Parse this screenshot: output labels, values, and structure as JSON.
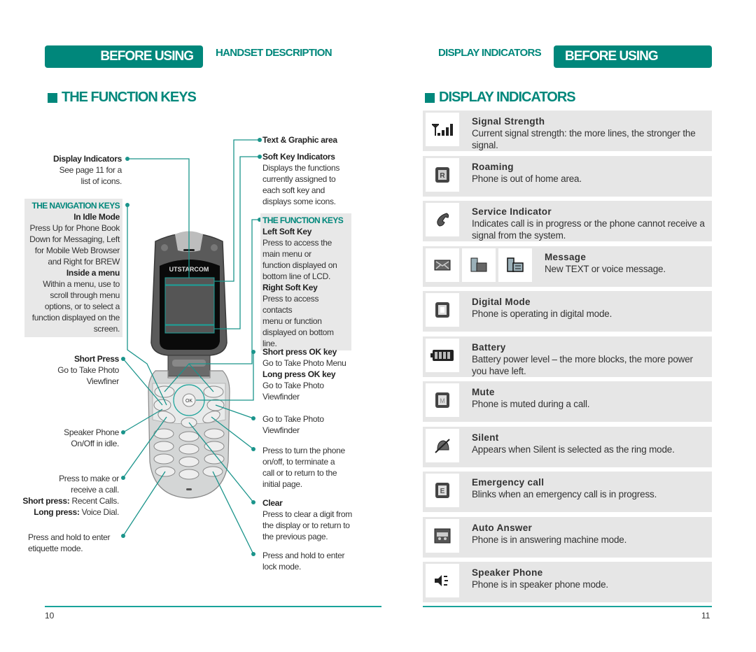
{
  "header": {
    "left_section": "BEFORE USING",
    "left_crumb": "HANDSET DESCRIPTION",
    "right_crumb": "DISPLAY INDICATORS",
    "right_section": "BEFORE USING"
  },
  "left_page": {
    "title": "THE FUNCTION KEYS",
    "page_number": "10",
    "phone_brand": "UTSTARCOM",
    "left_callouts": {
      "display_indicators": {
        "title": "Display Indicators",
        "lines": [
          "See page 11 for a",
          "list of icons."
        ]
      },
      "navigation_keys": {
        "header": "THE NAVIGATION KEYS",
        "idle_title": "In Idle Mode",
        "idle_lines": [
          "Press Up for Phone Book",
          "Down for Messaging, Left",
          "for Mobile Web Browser",
          "and Right for BREW"
        ],
        "menu_title": "Inside a menu",
        "menu_lines": [
          "Within a menu, use to",
          "scroll through menu",
          "options, or to select a",
          "function displayed on the",
          "screen."
        ]
      },
      "short_press": {
        "title": "Short Press",
        "lines": [
          "Go to Take Photo",
          "Viewfiner"
        ]
      },
      "speaker_phone": {
        "lines": [
          "Speaker Phone",
          "On/Off in idle."
        ]
      },
      "send": {
        "lines": [
          "Press to make or",
          "receive a call."
        ],
        "short_label": "Short press:",
        "short_value": " Recent Calls.",
        "long_label": "Long press:",
        "long_value": " Voice Dial."
      },
      "etiquette": {
        "lines": [
          "Press and hold to enter",
          "etiquette mode."
        ]
      }
    },
    "right_callouts": {
      "text_graphic": {
        "title": "Text & Graphic area"
      },
      "soft_key_indicators": {
        "title": "Soft Key Indicators",
        "lines": [
          "Displays the functions",
          "currently assigned to",
          "each soft key and",
          "displays some icons."
        ]
      },
      "function_keys": {
        "header": "THE FUNCTION KEYS",
        "left_title": "Left Soft Key",
        "left_lines": [
          "Press to access the",
          "main menu or",
          "function displayed on",
          "bottom line of LCD."
        ],
        "right_title": "Right Soft Key",
        "right_lines": [
          "Press to access contacts",
          "menu or function",
          "displayed on bottom",
          "line."
        ]
      },
      "ok_key": {
        "short_title": "Short press OK key",
        "short_line": "Go to Take Photo Menu",
        "long_title": "Long press OK key",
        "long_lines": [
          "Go to Take Photo",
          "Viewfinder"
        ]
      },
      "camera": {
        "lines": [
          "Go to Take Photo",
          "Viewfinder"
        ]
      },
      "end": {
        "lines": [
          "Press to turn the phone",
          "on/off, to terminate a",
          "call or to return to the",
          "initial page."
        ]
      },
      "clear": {
        "title": "Clear",
        "lines": [
          "Press to clear a digit from",
          "the display or to return to",
          "the previous page."
        ]
      },
      "lock": {
        "lines": [
          "Press and hold to enter",
          "lock mode."
        ]
      }
    }
  },
  "right_page": {
    "title": "DISPLAY INDICATORS",
    "page_number": "11",
    "indicators": [
      {
        "icon": "signal-strength-icon",
        "title": "Signal Strength",
        "desc": "Current signal strength: the more lines, the stronger the signal."
      },
      {
        "icon": "roaming-icon",
        "title": "Roaming",
        "desc": "Phone is out of home area."
      },
      {
        "icon": "service-indicator-icon",
        "title": "Service Indicator",
        "desc": "Indicates call is in progress or the phone cannot receive a signal from the system."
      },
      {
        "icon": "message-icon",
        "title": "Message",
        "desc": "New TEXT or voice message."
      },
      {
        "icon": "digital-mode-icon",
        "title": "Digital Mode",
        "desc": "Phone is operating in digital mode."
      },
      {
        "icon": "battery-icon",
        "title": "Battery",
        "desc": "Battery power level – the more blocks, the more power you have left."
      },
      {
        "icon": "mute-icon",
        "title": "Mute",
        "desc": "Phone is muted during a call."
      },
      {
        "icon": "silent-icon",
        "title": "Silent",
        "desc": "Appears when Silent is selected as the ring mode."
      },
      {
        "icon": "emergency-call-icon",
        "title": "Emergency call",
        "desc": "Blinks when an emergency call is in progress."
      },
      {
        "icon": "auto-answer-icon",
        "title": "Auto Answer",
        "desc": "Phone is in answering machine mode."
      },
      {
        "icon": "speaker-phone-icon",
        "title": "Speaker Phone",
        "desc": "Phone is in speaker phone mode."
      }
    ]
  },
  "colors": {
    "accent": "#00877b",
    "panel": "#e6e6e6",
    "rule": "#1aa39a"
  }
}
